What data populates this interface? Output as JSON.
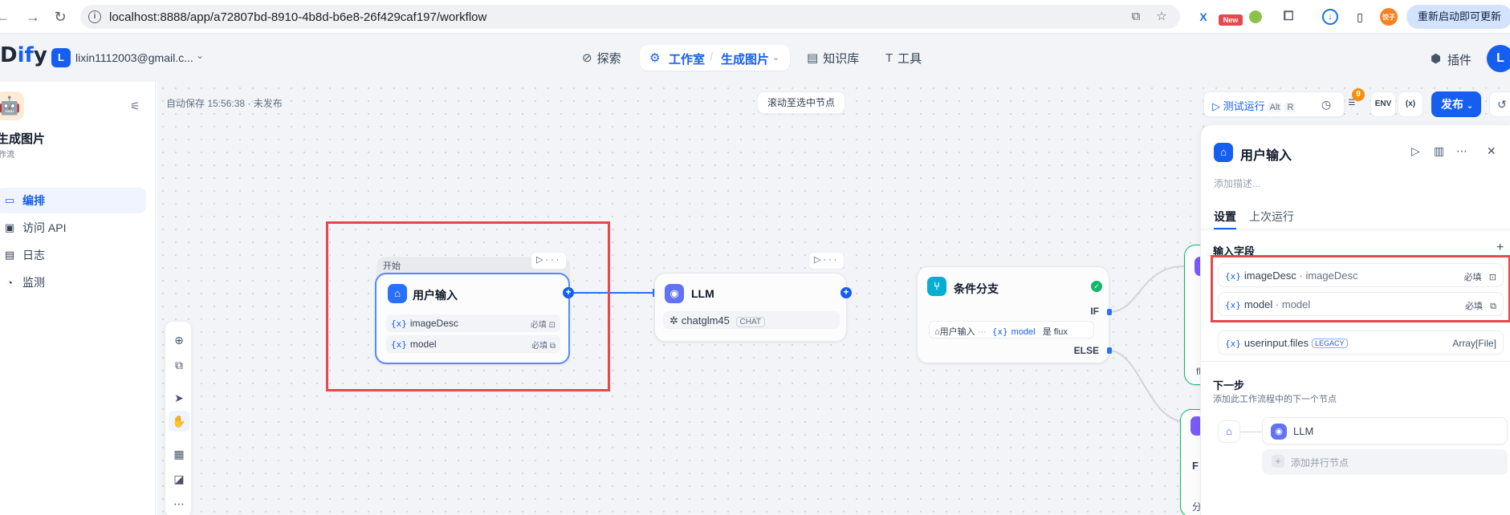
{
  "browser": {
    "back_icon": "arrow-left",
    "forward_icon": "arrow-right",
    "reload_icon": "reload",
    "url": "localhost:8888/app/a72807bd-8910-4b8d-b6e8-26f429caf197/workflow",
    "ext_badge_new": "New",
    "ext_avatar_text": "饺子",
    "update_label": "重新启动即可更新"
  },
  "header": {
    "logo_left": "D",
    "logo_accent": "if",
    "logo_right": "y",
    "account_initial": "L",
    "account_email": "lixin1112003@gmail.c...",
    "nav": {
      "explore": "探索",
      "studio": "工作室",
      "current_app": "生成图片",
      "knowledge": "知识库",
      "tools": "工具"
    },
    "plugins": "插件",
    "user_initial": "L"
  },
  "sidebar": {
    "app_name": "生成图片",
    "app_type": "作流",
    "items": [
      {
        "icon": "layout-icon",
        "label": "编排",
        "active": true
      },
      {
        "icon": "terminal-icon",
        "label": "访问 API",
        "active": false
      },
      {
        "icon": "log-icon",
        "label": "日志",
        "active": false
      },
      {
        "icon": "monitor-icon",
        "label": "监测",
        "active": false
      }
    ]
  },
  "canvas": {
    "autosave": "自动保存 15:56:38 · 未发布",
    "scroll_to_selected": "滚动至选中节点"
  },
  "toolbar": {
    "test_run": "测试运行",
    "shortcut_alt": "Alt",
    "shortcut_r": "R",
    "checklist_count": "9",
    "env_label": "ENV",
    "var_label": "(x)",
    "publish": "发布"
  },
  "nodes": {
    "start": {
      "tag": "开始",
      "title": "用户输入",
      "fields": [
        {
          "name": "imageDesc",
          "required": "必填"
        },
        {
          "name": "model",
          "required": "必填"
        }
      ]
    },
    "llm": {
      "title": "LLM",
      "model": "chatglm45",
      "mode": "CHAT"
    },
    "ifelse": {
      "title": "条件分支",
      "if_label": "IF",
      "else_label": "ELSE",
      "cond_node": "用户输入",
      "cond_ellipsis": "···",
      "cond_var": "model",
      "cond_op": "是",
      "cond_value": "flux"
    },
    "partial_label_fl": "fl",
    "partial_label_f": "F",
    "partial_label_fen": "分"
  },
  "panel": {
    "title": "用户输入",
    "desc_placeholder": "添加描述...",
    "tabs": [
      "设置",
      "上次运行"
    ],
    "input_section": "输入字段",
    "fields": [
      {
        "name": "imageDesc",
        "label": "imageDesc",
        "required": "必填"
      },
      {
        "name": "model",
        "label": "model",
        "required": "必填"
      }
    ],
    "system_field": "userinput.files",
    "system_badge": "LEGACY",
    "system_type": "Array[File]",
    "next_step": "下一步",
    "next_step_desc": "添加此工作流程中的下一个节点",
    "next_node": "LLM",
    "add_parallel": "添加并行节点"
  },
  "colors": {
    "accent": "#155eef",
    "highlight": "#e5484d",
    "ifelse_green": "#12b76a"
  }
}
